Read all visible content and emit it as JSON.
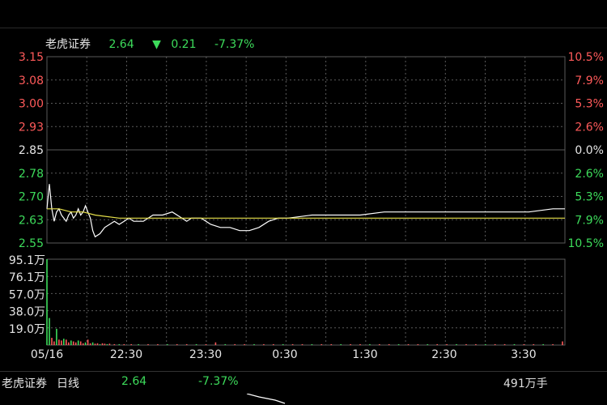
{
  "header": {
    "stock_name": "老虎证券",
    "price": "2.64",
    "arrow": "▼",
    "change": "0.21",
    "change_pct": "-7.37%"
  },
  "footer": {
    "stock_name": "老虎证券",
    "period": "日线",
    "price": "2.64",
    "change_pct": "-7.37%",
    "volume": "491万手"
  },
  "colors": {
    "up": "#ff5a5a",
    "down": "#3ddc5b",
    "neutral": "#e6e6e6",
    "grid": "#5a5a5a",
    "price_line": "#ffffff",
    "avg_line": "#e6e04a"
  },
  "chart_data": [
    {
      "type": "line",
      "title": "",
      "ylim": [
        2.55,
        3.15
      ],
      "y_ticks_left": [
        "3.15",
        "3.08",
        "3.00",
        "2.93",
        "2.85",
        "2.78",
        "2.70",
        "2.63",
        "2.55"
      ],
      "y_ticks_right": [
        "10.5%",
        "7.9%",
        "5.3%",
        "2.6%",
        "0.0%",
        "2.6%",
        "5.3%",
        "7.9%",
        "10.5%"
      ],
      "prev_close": 2.85,
      "x_ticks": [
        "05/16",
        "22:30",
        "23:30",
        "0:30",
        "1:30",
        "2:30",
        "3:30"
      ],
      "series": [
        {
          "values": [
            [
              0,
              2.66
            ],
            [
              1,
              2.74
            ],
            [
              2,
              2.66
            ],
            [
              3,
              2.62
            ],
            [
              4,
              2.65
            ],
            [
              5,
              2.66
            ],
            [
              6,
              2.64
            ],
            [
              7,
              2.63
            ],
            [
              8,
              2.62
            ],
            [
              9,
              2.64
            ],
            [
              10,
              2.65
            ],
            [
              11,
              2.63
            ],
            [
              12,
              2.64
            ],
            [
              13,
              2.66
            ],
            [
              14,
              2.64
            ],
            [
              15,
              2.65
            ],
            [
              16,
              2.67
            ],
            [
              17,
              2.65
            ],
            [
              18,
              2.63
            ],
            [
              19,
              2.59
            ],
            [
              20,
              2.57
            ],
            [
              22,
              2.58
            ],
            [
              24,
              2.6
            ],
            [
              26,
              2.61
            ],
            [
              28,
              2.62
            ],
            [
              30,
              2.61
            ],
            [
              32,
              2.62
            ],
            [
              34,
              2.63
            ],
            [
              36,
              2.62
            ],
            [
              40,
              2.62
            ],
            [
              44,
              2.64
            ],
            [
              48,
              2.64
            ],
            [
              52,
              2.65
            ],
            [
              56,
              2.63
            ],
            [
              58,
              2.62
            ],
            [
              60,
              2.63
            ],
            [
              64,
              2.63
            ],
            [
              68,
              2.61
            ],
            [
              72,
              2.6
            ],
            [
              76,
              2.6
            ],
            [
              80,
              2.59
            ],
            [
              84,
              2.59
            ],
            [
              88,
              2.6
            ],
            [
              92,
              2.62
            ],
            [
              96,
              2.63
            ],
            [
              100,
              2.63
            ],
            [
              110,
              2.64
            ],
            [
              120,
              2.64
            ],
            [
              130,
              2.64
            ],
            [
              140,
              2.65
            ],
            [
              150,
              2.65
            ],
            [
              160,
              2.65
            ],
            [
              170,
              2.65
            ],
            [
              180,
              2.65
            ],
            [
              190,
              2.65
            ],
            [
              200,
              2.65
            ],
            [
              210,
              2.66
            ],
            [
              215,
              2.66
            ]
          ]
        },
        {
          "values": [
            [
              0,
              2.66
            ],
            [
              5,
              2.66
            ],
            [
              10,
              2.65
            ],
            [
              15,
              2.65
            ],
            [
              20,
              2.64
            ],
            [
              30,
              2.63
            ],
            [
              40,
              2.63
            ],
            [
              60,
              2.63
            ],
            [
              80,
              2.63
            ],
            [
              100,
              2.63
            ],
            [
              130,
              2.63
            ],
            [
              160,
              2.63
            ],
            [
              190,
              2.63
            ],
            [
              215,
              2.63
            ]
          ]
        }
      ],
      "x_range": [
        0,
        215
      ]
    },
    {
      "type": "bar",
      "title": "",
      "ylim": [
        0,
        95.1
      ],
      "y_ticks": [
        "95.1万",
        "76.1万",
        "57.0万",
        "38.0万",
        "19.0万"
      ],
      "values": [
        [
          0,
          95.1
        ],
        [
          1,
          30
        ],
        [
          2,
          8
        ],
        [
          3,
          4
        ],
        [
          4,
          18
        ],
        [
          5,
          6
        ],
        [
          6,
          5
        ],
        [
          7,
          7
        ],
        [
          8,
          6
        ],
        [
          9,
          3
        ],
        [
          10,
          5
        ],
        [
          11,
          4
        ],
        [
          12,
          3
        ],
        [
          13,
          5
        ],
        [
          14,
          4
        ],
        [
          15,
          2
        ],
        [
          16,
          3
        ],
        [
          17,
          6
        ],
        [
          18,
          2
        ],
        [
          19,
          3
        ],
        [
          20,
          1.5
        ],
        [
          21,
          2
        ],
        [
          22,
          1
        ],
        [
          23,
          2
        ],
        [
          24,
          1.5
        ],
        [
          25,
          1
        ],
        [
          26,
          1.5
        ],
        [
          28,
          1
        ],
        [
          30,
          1
        ],
        [
          32,
          1
        ],
        [
          35,
          1
        ],
        [
          38,
          1
        ],
        [
          42,
          1
        ],
        [
          46,
          1
        ],
        [
          50,
          1
        ],
        [
          54,
          1
        ],
        [
          58,
          1
        ],
        [
          62,
          1
        ],
        [
          66,
          1
        ],
        [
          70,
          3
        ],
        [
          74,
          1
        ],
        [
          78,
          1
        ],
        [
          82,
          1
        ],
        [
          86,
          1
        ],
        [
          90,
          1
        ],
        [
          94,
          1
        ],
        [
          98,
          1
        ],
        [
          102,
          1
        ],
        [
          106,
          1
        ],
        [
          110,
          1
        ],
        [
          114,
          1
        ],
        [
          118,
          1
        ],
        [
          122,
          1
        ],
        [
          126,
          1
        ],
        [
          130,
          1
        ],
        [
          134,
          1
        ],
        [
          138,
          1
        ],
        [
          142,
          1
        ],
        [
          146,
          1
        ],
        [
          150,
          1
        ],
        [
          154,
          1
        ],
        [
          158,
          1
        ],
        [
          162,
          1
        ],
        [
          166,
          1
        ],
        [
          170,
          1
        ],
        [
          174,
          1
        ],
        [
          178,
          1
        ],
        [
          182,
          1
        ],
        [
          186,
          1
        ],
        [
          190,
          1
        ],
        [
          194,
          1
        ],
        [
          198,
          1
        ],
        [
          202,
          1
        ],
        [
          206,
          1
        ],
        [
          210,
          1
        ],
        [
          214,
          4
        ]
      ]
    }
  ]
}
